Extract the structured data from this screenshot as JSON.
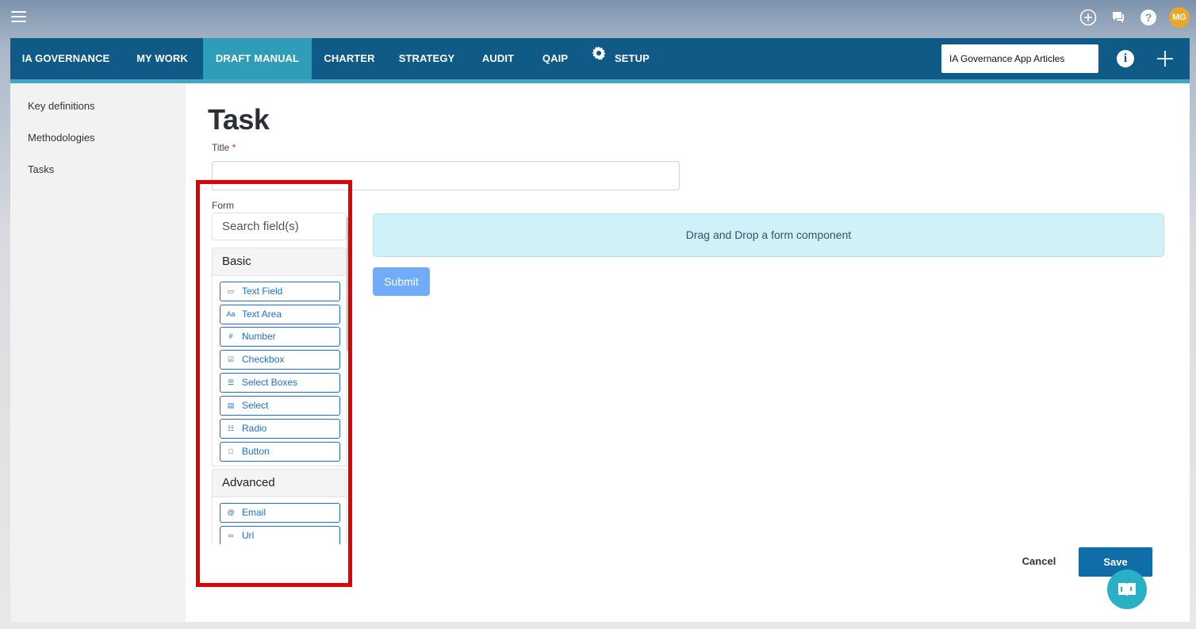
{
  "topbar": {
    "avatar_initials": "MG",
    "icons": [
      "menu-icon",
      "add-circle-icon",
      "chat-icon",
      "help-icon"
    ]
  },
  "nav": {
    "items": [
      {
        "label": "IA GOVERNANCE"
      },
      {
        "label": "MY WORK"
      },
      {
        "label": "DRAFT MANUAL",
        "active": true
      },
      {
        "label": "CHARTER"
      },
      {
        "label": "STRATEGY"
      },
      {
        "label": "AUDIT"
      },
      {
        "label": "QAIP"
      },
      {
        "label": "SETUP",
        "icon": "gear-icon"
      }
    ],
    "search_value": "IA Governance App Articles"
  },
  "sidebar": {
    "items": [
      {
        "label": "Key definitions"
      },
      {
        "label": "Methodologies"
      },
      {
        "label": "Tasks"
      }
    ]
  },
  "page": {
    "title": "Task",
    "title_field_label": "Title",
    "required_marker": "*",
    "title_value": ""
  },
  "form_builder": {
    "label": "Form",
    "search_placeholder": "Search field(s)",
    "groups": [
      {
        "name": "Basic",
        "components": [
          {
            "label": "Text Field",
            "icon": "terminal-icon"
          },
          {
            "label": "Text Area",
            "icon": "font-icon"
          },
          {
            "label": "Number",
            "icon": "hash-icon"
          },
          {
            "label": "Checkbox",
            "icon": "checkbox-icon"
          },
          {
            "label": "Select Boxes",
            "icon": "list-icon"
          },
          {
            "label": "Select",
            "icon": "select-list-icon"
          },
          {
            "label": "Radio",
            "icon": "radio-list-icon"
          },
          {
            "label": "Button",
            "icon": "stop-icon"
          }
        ]
      },
      {
        "name": "Advanced",
        "components": [
          {
            "label": "Email",
            "icon": "at-icon"
          },
          {
            "label": "Url",
            "icon": "link-icon"
          }
        ]
      }
    ],
    "dropzone_text": "Drag and Drop a form component",
    "submit_label": "Submit"
  },
  "footer": {
    "cancel_label": "Cancel",
    "save_label": "Save"
  },
  "colors": {
    "nav_bg": "#0f5a86",
    "nav_active": "#2f9cb8",
    "highlight": "#e10000",
    "component_blue": "#1f6fd1",
    "dropzone": "#d1f1f9",
    "save": "#0f6ea8"
  }
}
